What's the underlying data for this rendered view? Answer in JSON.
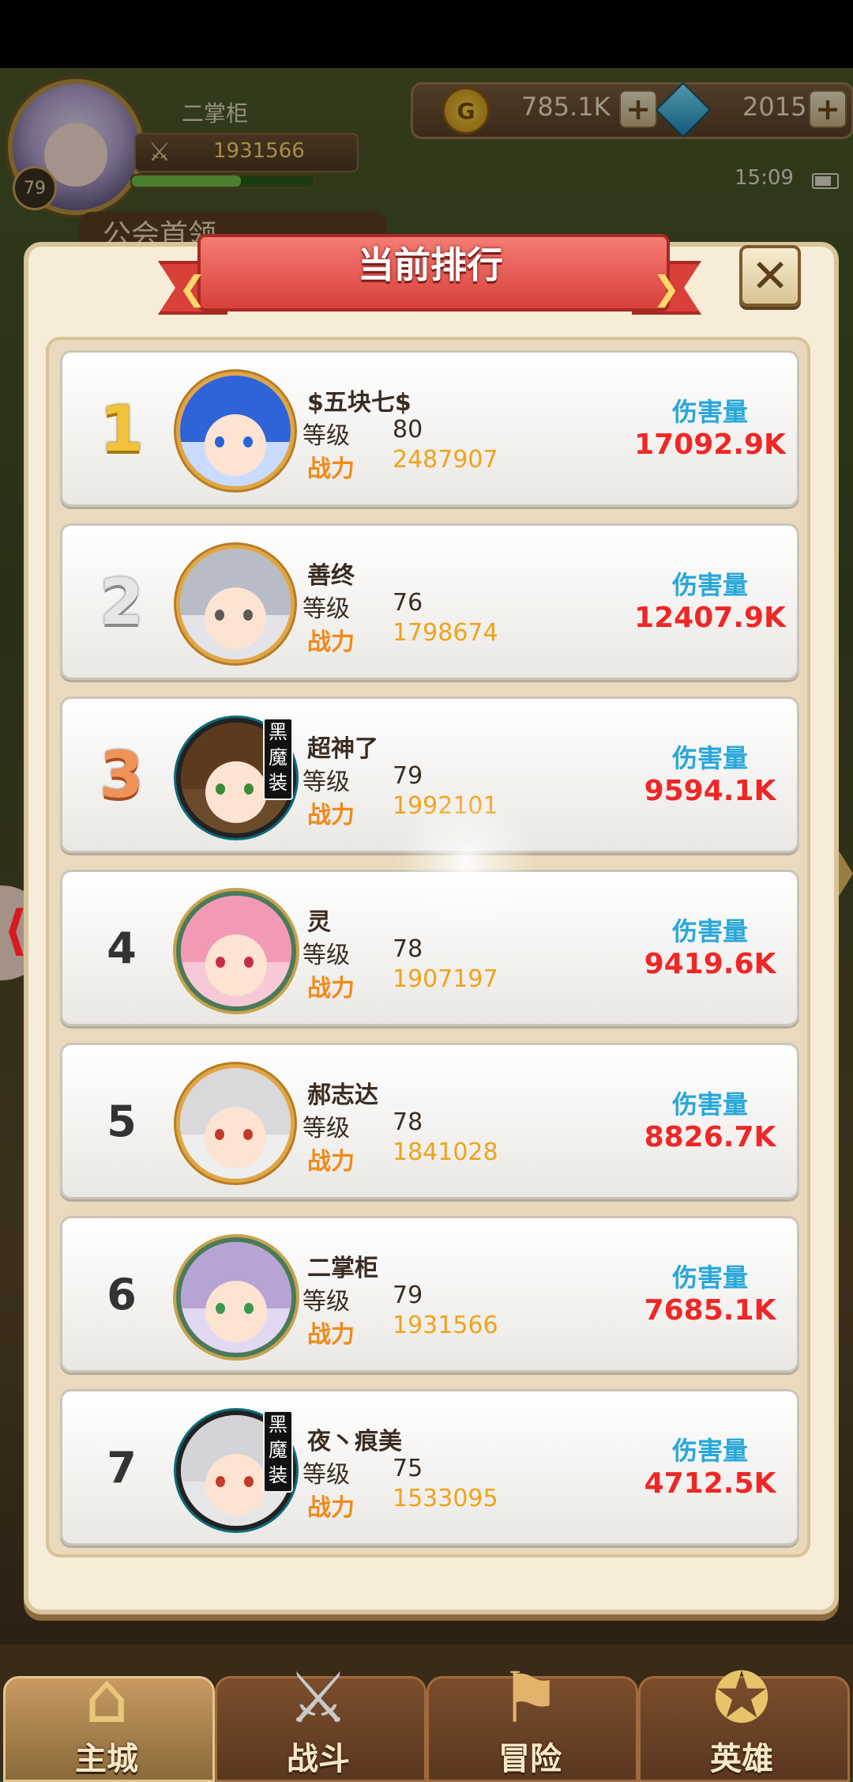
{
  "hud": {
    "player_name": "二掌柜",
    "level": "79",
    "power": "1931566",
    "gold": "785.1K",
    "gems": "2015",
    "time": "15:09",
    "exp_fraction": 0.6,
    "bg_tab": "公会首领",
    "icons": {
      "coin": "coin-icon",
      "gem": "gem-icon",
      "plus": "+",
      "battery": "battery-icon",
      "crossed_swords": "⚔"
    }
  },
  "dialog": {
    "title": "当前排行",
    "close_symbol": "✕",
    "chev_left": "❮",
    "chev_right": "❯"
  },
  "labels": {
    "level": "等级",
    "power": "战力",
    "damage": "伤害量"
  },
  "rankings": [
    {
      "rank": "1",
      "name": "$五块七$",
      "level": "80",
      "power": "2487907",
      "damage": "17092.9K"
    },
    {
      "rank": "2",
      "name": "善终",
      "level": "76",
      "power": "1798674",
      "damage": "12407.9K"
    },
    {
      "rank": "3",
      "name": "超神了",
      "level": "79",
      "power": "1992101",
      "damage": "9594.1K",
      "badge": "黑魔装"
    },
    {
      "rank": "4",
      "name": "灵",
      "level": "78",
      "power": "1907197",
      "damage": "9419.6K"
    },
    {
      "rank": "5",
      "name": "郝志达",
      "level": "78",
      "power": "1841028",
      "damage": "8826.7K"
    },
    {
      "rank": "6",
      "name": "二掌柜",
      "level": "79",
      "power": "1931566",
      "damage": "7685.1K"
    },
    {
      "rank": "7",
      "name": "夜丶痕美",
      "level": "75",
      "power": "1533095",
      "damage": "4712.5K",
      "badge": "黑魔装"
    }
  ],
  "nav": [
    {
      "label": "主城",
      "icon": "castle-icon",
      "glyph": "⌂"
    },
    {
      "label": "战斗",
      "icon": "swords-icon",
      "glyph": "⚔"
    },
    {
      "label": "冒险",
      "icon": "map-icon",
      "glyph": "⚑"
    },
    {
      "label": "英雄",
      "icon": "crest-icon",
      "glyph": "✪"
    }
  ],
  "side": {
    "left_arrow": "⟨"
  },
  "colors": {
    "damage_label": "#29a7d9",
    "damage_value": "#ee2727",
    "power_label": "#f08a1a",
    "ribbon": "#d9403a"
  }
}
